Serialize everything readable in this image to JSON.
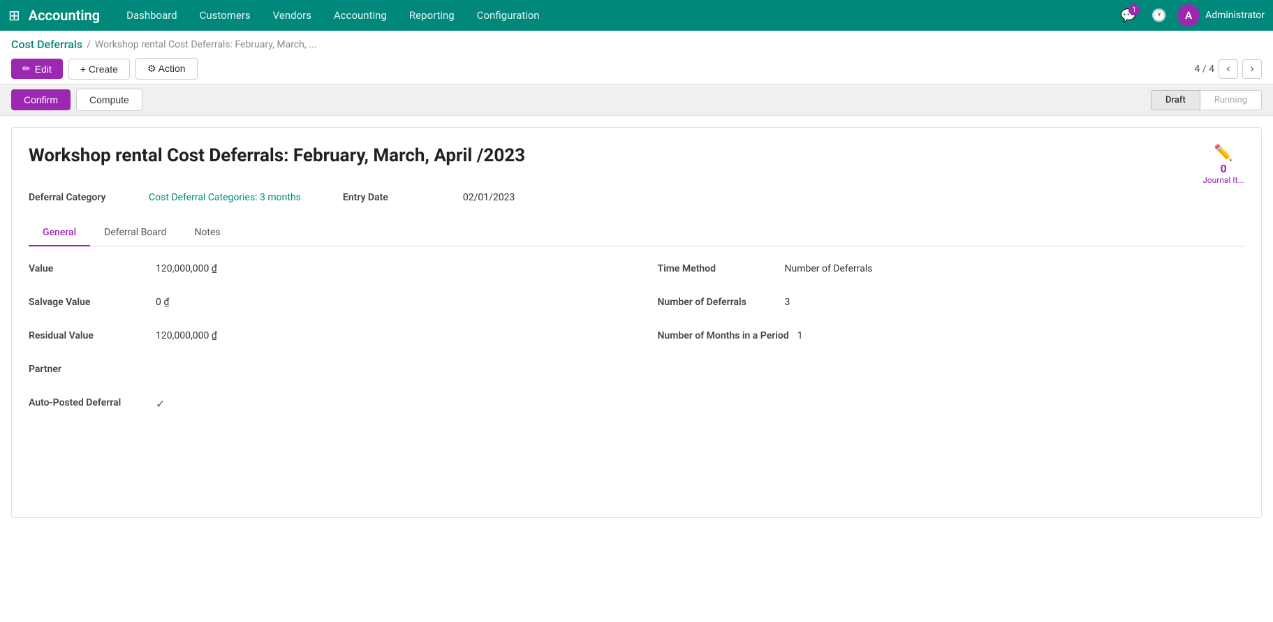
{
  "topnav": {
    "brand": "Accounting",
    "links": [
      {
        "label": "Dashboard",
        "key": "dashboard"
      },
      {
        "label": "Customers",
        "key": "customers"
      },
      {
        "label": "Vendors",
        "key": "vendors"
      },
      {
        "label": "Accounting",
        "key": "accounting"
      },
      {
        "label": "Reporting",
        "key": "reporting"
      },
      {
        "label": "Configuration",
        "key": "configuration"
      }
    ],
    "notification_count": "1",
    "avatar_initial": "A",
    "user_label": "Administrator"
  },
  "breadcrumb": {
    "root": "Cost Deferrals",
    "separator": "/",
    "current": "Workshop rental Cost Deferrals: February, March, ..."
  },
  "toolbar": {
    "edit_label": "Edit",
    "create_label": "+ Create",
    "action_label": "⚙ Action",
    "pager_text": "4 / 4"
  },
  "action_bar": {
    "confirm_label": "Confirm",
    "compute_label": "Compute",
    "status_draft": "Draft",
    "status_running": "Running"
  },
  "form": {
    "title": "Workshop rental Cost Deferrals: February, March, April /2023",
    "journal_items_count": "0",
    "journal_items_label": "Journal It...",
    "deferral_category_label": "Deferral Category",
    "deferral_category_value": "Cost Deferral Categories: 3 months",
    "entry_date_label": "Entry Date",
    "entry_date_value": "02/01/2023"
  },
  "tabs": [
    {
      "key": "general",
      "label": "General",
      "active": true
    },
    {
      "key": "deferral-board",
      "label": "Deferral Board",
      "active": false
    },
    {
      "key": "notes",
      "label": "Notes",
      "active": false
    }
  ],
  "general_tab": {
    "left": {
      "value_label": "Value",
      "value": "120,000,000 ₫",
      "salvage_value_label": "Salvage Value",
      "salvage_value": "0 ₫",
      "residual_value_label": "Residual Value",
      "residual_value": "120,000,000 ₫",
      "partner_label": "Partner",
      "partner_value": "",
      "auto_posted_label": "Auto-Posted Deferral",
      "auto_posted_value": "✓"
    },
    "right": {
      "time_method_label": "Time Method",
      "time_method_value": "Number of Deferrals",
      "num_deferrals_label": "Number of Deferrals",
      "num_deferrals_value": "3",
      "num_months_label": "Number of Months in a Period",
      "num_months_value": "1"
    }
  }
}
